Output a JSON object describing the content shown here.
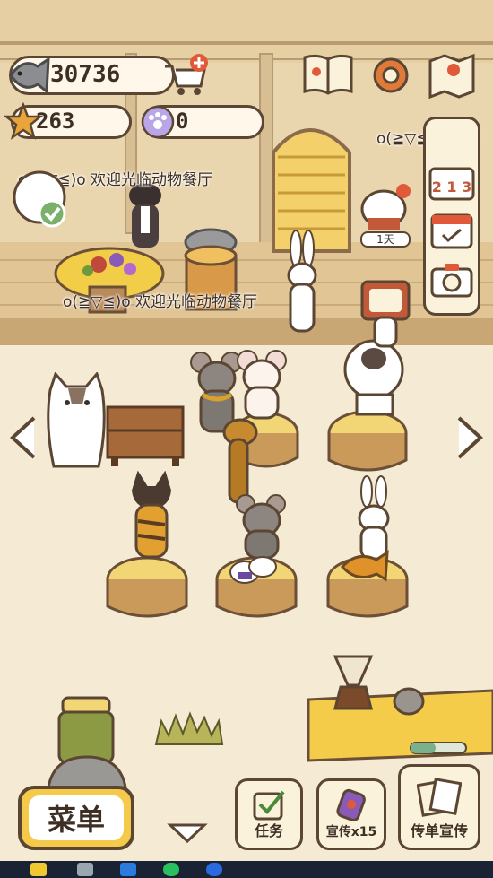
{
  "currency": {
    "fish": "30736",
    "stars": "263",
    "paw_coins": "0"
  },
  "banners": {
    "welcome_1": "o(≧▽≦)o 欢迎光临动物餐厅",
    "welcome_2": "o(≧▽≦)o 欢迎光临动物餐厅",
    "welcome_3": "o(≧▽≦)o 欢迎"
  },
  "calendar_badge": {
    "label": "1天",
    "numbers": "2 1 3"
  },
  "bottom_bar": {
    "menu_label": "菜单",
    "tasks_label": "任务",
    "promo_label": "宣传x15",
    "flyer_label": "传单宣传"
  },
  "colors": {
    "outline": "#5b4634",
    "menu_button_fill": "#f5c94a",
    "background": "#f2e3c6",
    "wall": "#ead6ae"
  },
  "icons": [
    "fish-icon",
    "cart-plus-icon",
    "book-icon",
    "gear-icon",
    "map-icon",
    "star-icon",
    "paw-coin-icon",
    "calendar-icon",
    "camera-icon",
    "chevron-left-icon",
    "chevron-right-icon",
    "chevron-down-icon",
    "checkbox-icon",
    "megaphone-icon",
    "flyers-icon",
    "check-icon"
  ]
}
